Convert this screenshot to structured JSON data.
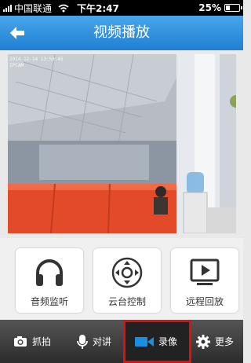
{
  "status_bar": {
    "carrier": "中国联通",
    "time": "下午2:47",
    "battery": "25%"
  },
  "header": {
    "title": "视频播放"
  },
  "video": {
    "timestamp_line1": "2014-12-14 13:59:45",
    "timestamp_line2": "IPCAM"
  },
  "actions": [
    {
      "label": "音频监听",
      "icon": "headphones-icon"
    },
    {
      "label": "云台控制",
      "icon": "ptz-control-icon"
    },
    {
      "label": "远程回放",
      "icon": "remote-playback-icon"
    }
  ],
  "toolbar": [
    {
      "label": "抓拍",
      "icon": "camera-icon"
    },
    {
      "label": "对讲",
      "icon": "microphone-icon"
    },
    {
      "label": "录像",
      "icon": "video-camera-icon",
      "active": true
    },
    {
      "label": "更多",
      "icon": "gear-icon"
    }
  ],
  "colors": {
    "header": "#2b8ce0",
    "accent": "#1a8fe0",
    "highlight_border": "#e01010"
  }
}
